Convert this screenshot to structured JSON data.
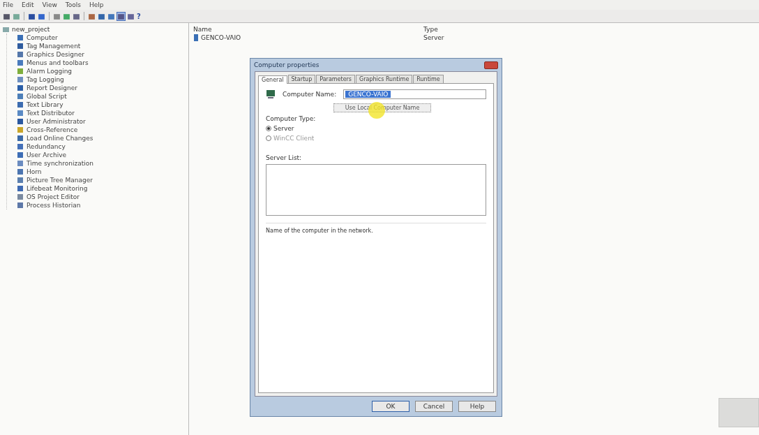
{
  "menu": [
    "File",
    "Edit",
    "View",
    "Tools",
    "Help"
  ],
  "toolbar": [
    {
      "kind": "icon",
      "selected": false
    },
    {
      "kind": "icon",
      "selected": false
    },
    {
      "kind": "sep"
    },
    {
      "kind": "icon",
      "selected": false
    },
    {
      "kind": "icon",
      "selected": false
    },
    {
      "kind": "sep"
    },
    {
      "kind": "icon",
      "selected": false
    },
    {
      "kind": "icon",
      "selected": false
    },
    {
      "kind": "icon",
      "selected": false
    },
    {
      "kind": "sep"
    },
    {
      "kind": "icon",
      "selected": false
    },
    {
      "kind": "icon",
      "selected": false
    },
    {
      "kind": "icon",
      "selected": false
    },
    {
      "kind": "icon",
      "selected": true
    },
    {
      "kind": "icon",
      "selected": false
    },
    {
      "kind": "help",
      "label": "?"
    }
  ],
  "tree": {
    "label": "new_project",
    "expanded": true,
    "children": [
      {
        "label": "Computer",
        "color": "#3a6fb5"
      },
      {
        "label": "Tag Management",
        "color": "#2f5c9e"
      },
      {
        "label": "Graphics Designer",
        "color": "#5577aa"
      },
      {
        "label": "Menus and toolbars",
        "color": "#4a7bbd"
      },
      {
        "label": "Alarm Logging",
        "color": "#7fae3c"
      },
      {
        "label": "Tag Logging",
        "color": "#6d8fc0"
      },
      {
        "label": "Report Designer",
        "color": "#2b5fa8"
      },
      {
        "label": "Global Script",
        "color": "#4d7fb8"
      },
      {
        "label": "Text Library",
        "color": "#3c6cb0"
      },
      {
        "label": "Text Distributor",
        "color": "#5a8ac4"
      },
      {
        "label": "User Administrator",
        "color": "#2a58a0"
      },
      {
        "label": "Cross-Reference",
        "color": "#c9a62a"
      },
      {
        "label": "Load Online Changes",
        "color": "#3b6aa8"
      },
      {
        "label": "Redundancy",
        "color": "#4470b8"
      },
      {
        "label": "User Archive",
        "color": "#3d6db5"
      },
      {
        "label": "Time synchronization",
        "color": "#6b8cc0"
      },
      {
        "label": "Horn",
        "color": "#4c75b0"
      },
      {
        "label": "Picture Tree Manager",
        "color": "#5b7fae"
      },
      {
        "label": "Lifebeat Monitoring",
        "color": "#3e6ab2"
      },
      {
        "label": "OS Project Editor",
        "color": "#7a8aa0"
      },
      {
        "label": "Process Historian",
        "color": "#5d78a8"
      }
    ]
  },
  "table": {
    "columns": [
      "Name",
      "Type"
    ],
    "rows": [
      [
        "GENCO-VAIO",
        "Server"
      ]
    ]
  },
  "dialog": {
    "title": "Computer properties",
    "tabs": [
      {
        "label": "General",
        "selected": true
      },
      {
        "label": "Startup",
        "selected": false
      },
      {
        "label": "Parameters",
        "selected": false
      },
      {
        "label": "Graphics Runtime",
        "selected": false
      },
      {
        "label": "Runtime",
        "selected": false
      }
    ],
    "computer_name_label": "Computer Name:",
    "computer_name": "GENCO-VAIO",
    "use_local_button": "Use Local Computer Name",
    "computer_type_label": "Computer Type:",
    "types": [
      {
        "label": "Server",
        "selected": true,
        "disabled": false
      },
      {
        "label": "WinCC Client",
        "selected": false,
        "disabled": true
      }
    ],
    "server_list_label": "Server List:",
    "hint": "Name of the computer in the network.",
    "buttons": [
      {
        "label": "OK",
        "default": true
      },
      {
        "label": "Cancel",
        "default": false
      },
      {
        "label": "Help",
        "default": false
      }
    ]
  }
}
